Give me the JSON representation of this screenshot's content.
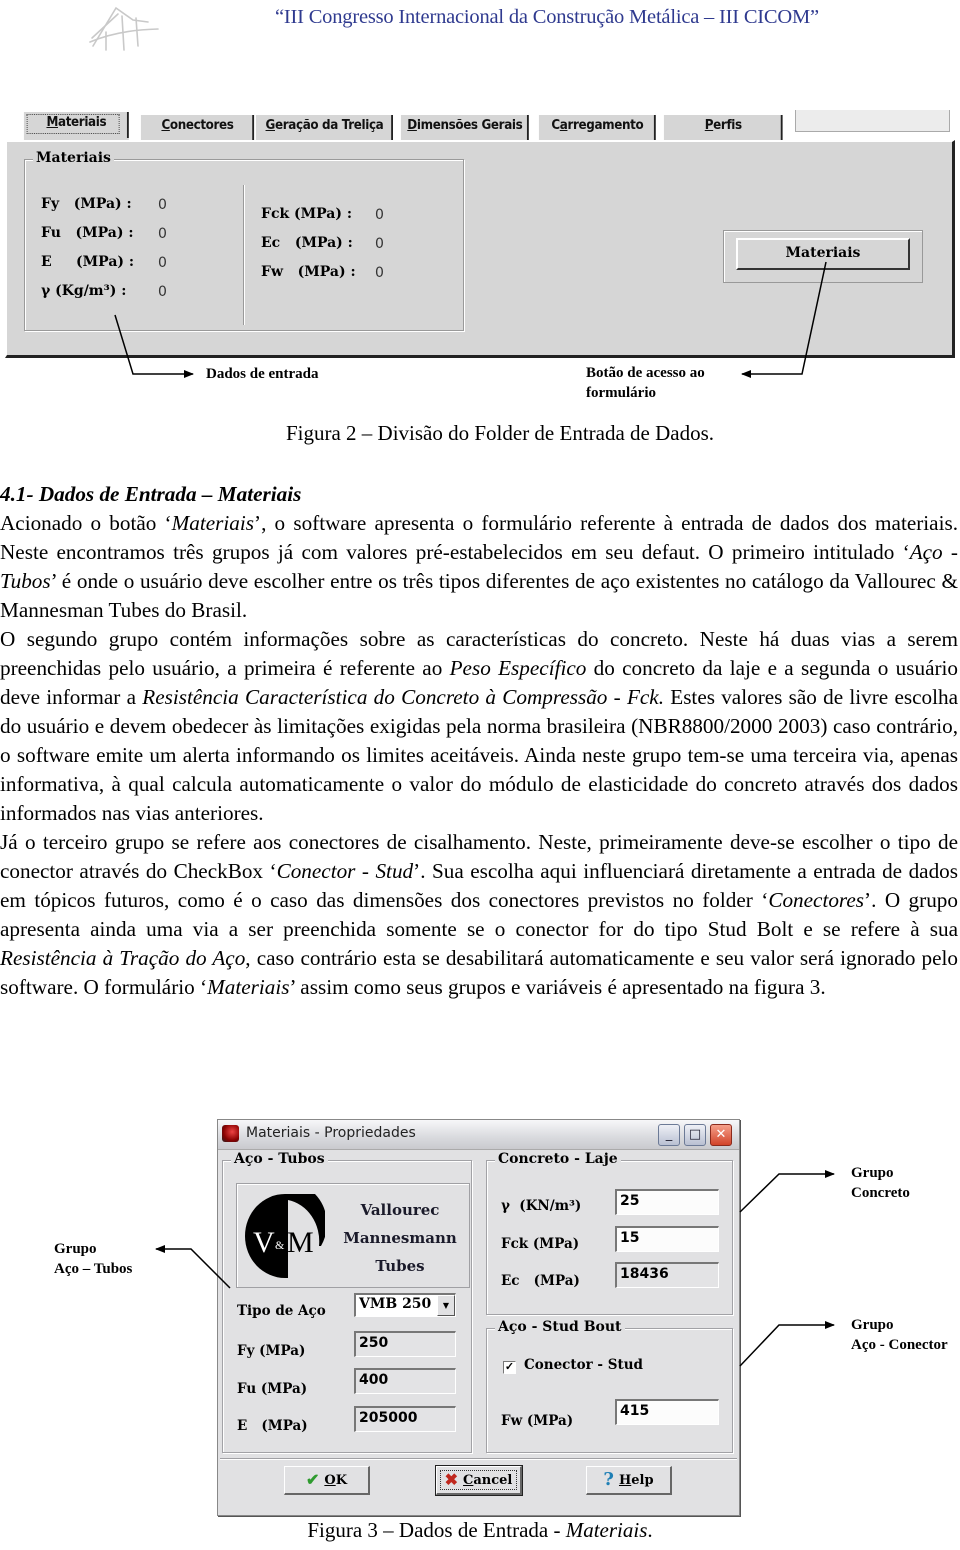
{
  "header": {
    "conference_title": "“III Congresso Internacional da Construção Metálica – III CICOM”"
  },
  "figure2": {
    "tabs": [
      {
        "label": "Materiais",
        "accel": "M",
        "active": true
      },
      {
        "label": "Conectores",
        "accel": "C",
        "active": false
      },
      {
        "label": "Geração da Treliça",
        "accel": "G",
        "active": false
      },
      {
        "label": "Dimensões Gerais",
        "accel": "D",
        "active": false
      },
      {
        "label": "Carregamento",
        "accel": "a",
        "active": false
      },
      {
        "label": "Perfis",
        "accel": "P",
        "active": false
      }
    ],
    "group_title": "Materiais",
    "left_props": [
      {
        "label": "Fy   (MPa) :",
        "value": "0"
      },
      {
        "label": "Fu   (MPa) :",
        "value": "0"
      },
      {
        "label": "E     (MPa) :",
        "value": "0"
      },
      {
        "label": "γ (Kg/m³) :",
        "value": "0"
      }
    ],
    "right_props": [
      {
        "label": "Fck (MPa) :",
        "value": "0"
      },
      {
        "label": "Ec   (MPa) :",
        "value": "0"
      },
      {
        "label": "Fw   (MPa) :",
        "value": "0"
      }
    ],
    "materials_button": "Materiais",
    "annotation_input": "Dados de entrada",
    "annotation_button_line1": "Botão de acesso ao",
    "annotation_button_line2": "formulário",
    "caption": "Figura 2 – Divisão do Folder de Entrada de Dados."
  },
  "body": {
    "heading": "4.1- Dados de Entrada – Materiais",
    "p1_a": "Acionado o botão ‘",
    "p1_i1": "Materiais",
    "p1_b": "’, o software apresenta o formulário referente à entrada de dados dos materiais. Neste encontramos três grupos já com valores pré-estabelecidos em seu defaut. O primeiro intitulado ‘",
    "p1_i2": "Aço - Tubos",
    "p1_c": "’ é onde o usuário deve escolher entre os três tipos diferentes de aço existentes no catálogo da Vallourec & Mannesman Tubes do Brasil.",
    "p2_a": "O segundo grupo contém informações sobre as características do concreto. Neste há duas vias a serem preenchidas pelo usuário, a primeira é referente ao ",
    "p2_i1": "Peso Específico",
    "p2_b": " do concreto da laje e a segunda o usuário deve informar a ",
    "p2_i2": "Resistência Característica do Concreto à Compressão - Fck.",
    "p2_c": " Estes valores são de livre escolha do usuário e devem obedecer às limitações exigidas pela norma brasileira (NBR8800/2000 2003) caso contrário, o software emite um alerta informando os limites aceitáveis. Ainda neste grupo tem-se uma terceira via, apenas informativa, à qual calcula automaticamente o valor do módulo de elasticidade do concreto através dos dados informados nas vias anteriores.",
    "p3_a": "Já o terceiro grupo se refere aos conectores de cisalhamento. Neste, primeiramente deve-se escolher o tipo de conector através do CheckBox ‘",
    "p3_i1": "Conector - Stud",
    "p3_b": "’. Sua escolha aqui influenciará diretamente a entrada de dados em tópicos futuros, como é o caso das dimensões dos conectores previstos no folder ‘",
    "p3_i2": "Conectores",
    "p3_c": "’. O grupo apresenta ainda uma via a ser preenchida somente se o conector for do tipo Stud Bolt e se refere à sua ",
    "p3_i3": "Resistência à Tração do Aço",
    "p3_d": ", caso contrário esta se desabilitará automaticamente e seu valor será ignorado pelo software. O formulário ‘",
    "p3_i4": "Materiais",
    "p3_e": "’ assim como seus grupos e variáveis é apresentado na figura 3."
  },
  "figure3": {
    "window_title": "Materiais - Propriedades",
    "window_buttons": {
      "minimize": "_",
      "maximize": "□",
      "close": "✕"
    },
    "group_aco_tubos": {
      "title": "Aço - Tubos",
      "logo_text": "V&M",
      "company_lines": [
        "Vallourec",
        "Mannesmann",
        "Tubes"
      ],
      "tipo_label": "Tipo de Aço",
      "tipo_value": "VMB 250",
      "fields": [
        {
          "label": "Fy (MPa)",
          "value": "250"
        },
        {
          "label": "Fu (MPa)",
          "value": "400"
        },
        {
          "label": "E   (MPa)",
          "value": "205000"
        }
      ]
    },
    "group_concreto": {
      "title": "Concreto - Laje",
      "fields": [
        {
          "label": "γ  (KN/m³)",
          "value": "25"
        },
        {
          "label": "Fck (MPa)",
          "value": "15"
        },
        {
          "label": "Ec   (MPa)",
          "value": "18436"
        }
      ]
    },
    "group_stud": {
      "title": "Aço - Stud Bout",
      "checkbox_label": "Conector - Stud",
      "checkbox_checked": true,
      "fw_label": "Fw (MPa)",
      "fw_value": "415"
    },
    "buttons": {
      "ok": {
        "accel": "O",
        "rest": "K"
      },
      "cancel": {
        "accel": "C",
        "rest": "ancel"
      },
      "help": {
        "accel": "H",
        "rest": "elp"
      }
    },
    "annotations": {
      "aco_tubos": [
        "Grupo",
        "Aço – Tubos"
      ],
      "concreto": [
        "Grupo",
        "Concreto"
      ],
      "conector": [
        "Grupo",
        "Aço - Conector"
      ]
    },
    "caption_a": "Figura 3 – Dados de Entrada - ",
    "caption_i": "Materiais",
    "caption_b": "."
  },
  "colors": {
    "conference_title": "#2f3a8f",
    "panel_gray": "#d6d6d6",
    "dialog_gray": "#e1e1e3",
    "ok_check": "#2f9b2f",
    "cancel_x": "#c0281e",
    "help_q": "#1e7fb5"
  }
}
